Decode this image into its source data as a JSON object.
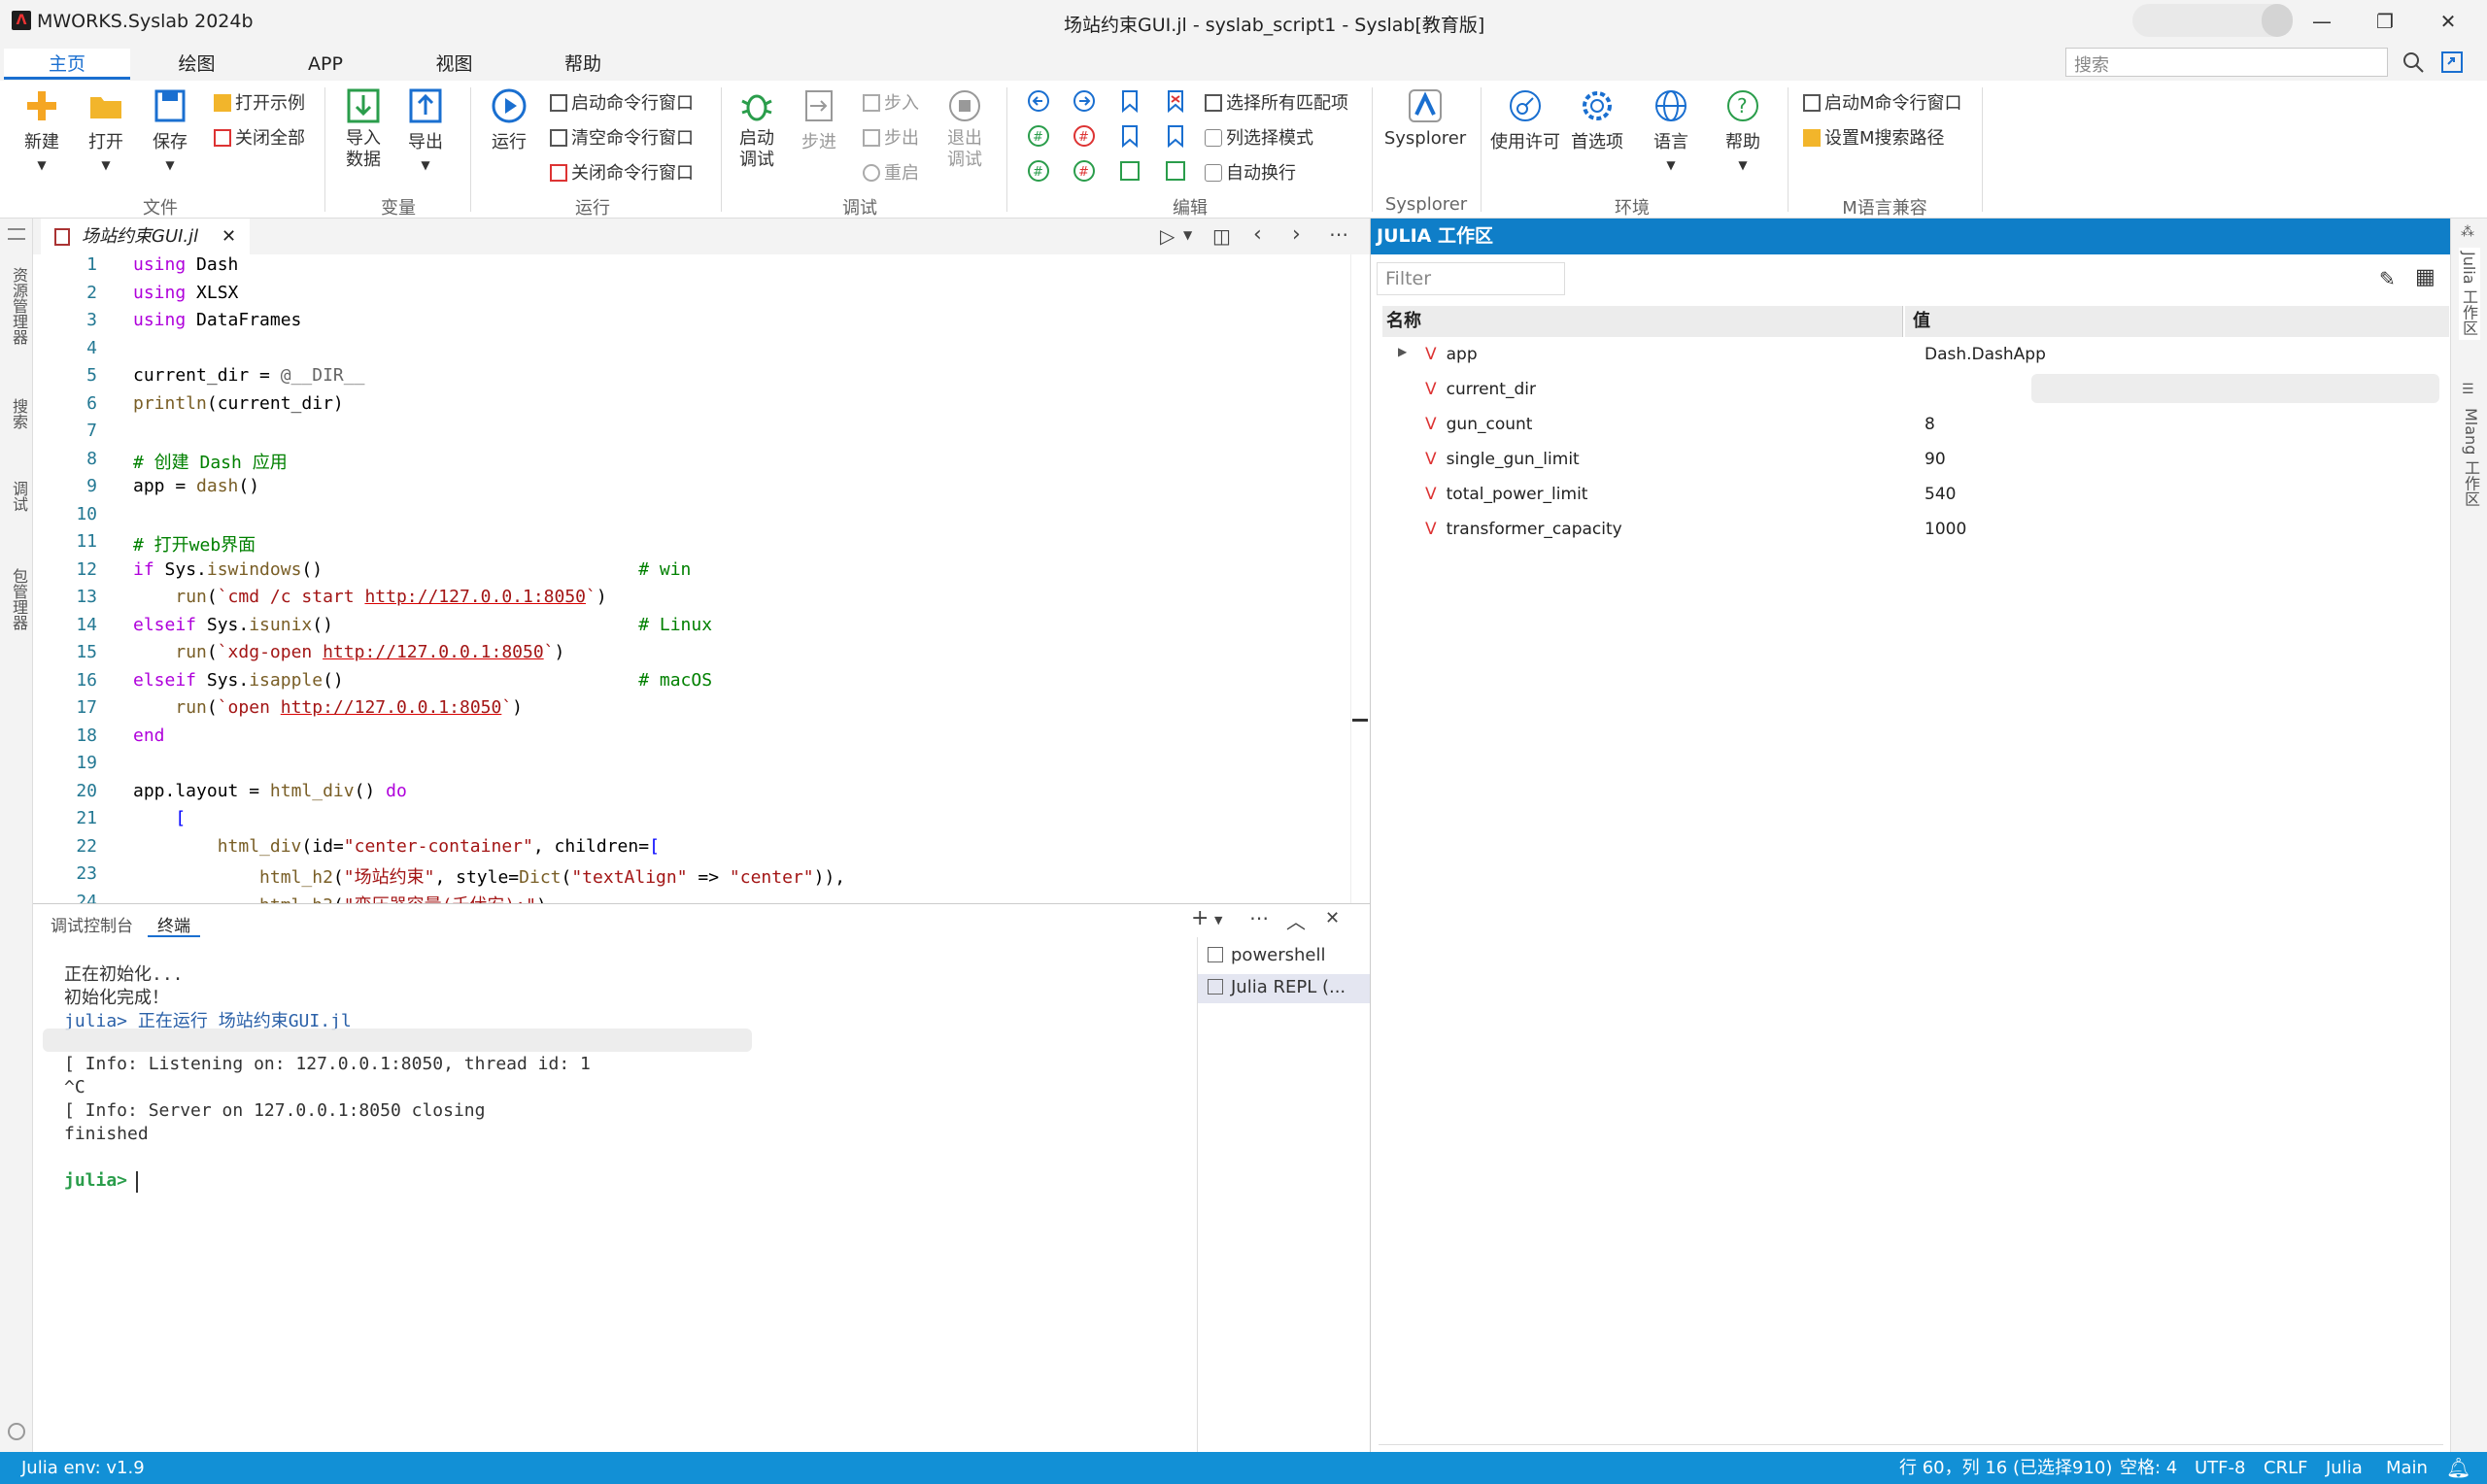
{
  "window": {
    "app_title": "MWORKS.Syslab 2024b",
    "doc_title": "场站约束GUI.jl - syslab_script1 - Syslab[教育版]"
  },
  "tabs": [
    "主页",
    "绘图",
    "APP",
    "视图",
    "帮助"
  ],
  "search": {
    "placeholder": "搜索"
  },
  "ribbon": {
    "file": {
      "new": "新建",
      "open": "打开",
      "save": "保存",
      "open_example": "打开示例",
      "close_all": "关闭全部",
      "group": "文件"
    },
    "variable": {
      "import": "导入数据",
      "export": "导出",
      "group": "变量"
    },
    "run": {
      "run": "运行",
      "start_cmd": "启动命令行窗口",
      "clear_cmd": "清空命令行窗口",
      "close_cmd": "关闭命令行窗口",
      "group": "运行"
    },
    "debug": {
      "start": "启动调试",
      "step_over": "步进",
      "step_in": "步入",
      "step_out": "步出",
      "restart": "重启",
      "exit": "退出调试",
      "group": "调试"
    },
    "edit": {
      "select_all": "选择所有匹配项",
      "column_mode": "列选择模式",
      "auto_wrap": "自动换行",
      "group": "编辑"
    },
    "sysplorer": {
      "label": "Sysplorer",
      "group": "Sysplorer"
    },
    "env": {
      "license": "使用许可",
      "prefs": "首选项",
      "lang": "语言",
      "help": "帮助",
      "group": "环境"
    },
    "mlang": {
      "start_m": "启动M命令行窗口",
      "set_path": "设置M搜索路径",
      "group": "M语言兼容"
    }
  },
  "left_strip": [
    "资源管理器",
    "搜索",
    "调试",
    "包管理器"
  ],
  "editor": {
    "filename": "场站约束GUI.jl",
    "line_numbers": [
      "1",
      "2",
      "3",
      "4",
      "5",
      "6",
      "7",
      "8",
      "9",
      "10",
      "11",
      "12",
      "13",
      "14",
      "15",
      "16",
      "17",
      "18",
      "19",
      "20",
      "21",
      "22",
      "23",
      "24"
    ]
  },
  "bottom": {
    "tab_debug": "调试控制台",
    "tab_terminal": "终端",
    "lines": [
      "正在初始化...",
      "初始化完成！",
      "julia> 正在运行 场站约束GUI.jl",
      "",
      "[ Info: Listening on: 127.0.0.1:8050, thread id: 1",
      "^C",
      "[ Info: Server on 127.0.0.1:8050 closing",
      "finished",
      "",
      "julia> "
    ],
    "terminals": [
      "powershell",
      "Julia REPL (..."
    ]
  },
  "workspace": {
    "title": "JULIA 工作区",
    "filter": "Filter",
    "col_name": "名称",
    "col_value": "值",
    "rows": [
      {
        "name": "app",
        "value": "Dash.DashApp"
      },
      {
        "name": "current_dir",
        "value": ""
      },
      {
        "name": "gun_count",
        "value": "8"
      },
      {
        "name": "single_gun_limit",
        "value": "90"
      },
      {
        "name": "total_power_limit",
        "value": "540"
      },
      {
        "name": "transformer_capacity",
        "value": "1000"
      }
    ]
  },
  "right_strip": [
    "Julia 工作区",
    "Mlang 工作区"
  ],
  "status": {
    "env": "Julia env: v1.9",
    "cursor": "行 60，列 16 (已选择910)",
    "spaces": "空格: 4",
    "encoding": "UTF-8",
    "eol": "CRLF",
    "lang": "Julia",
    "branch": "Main"
  }
}
